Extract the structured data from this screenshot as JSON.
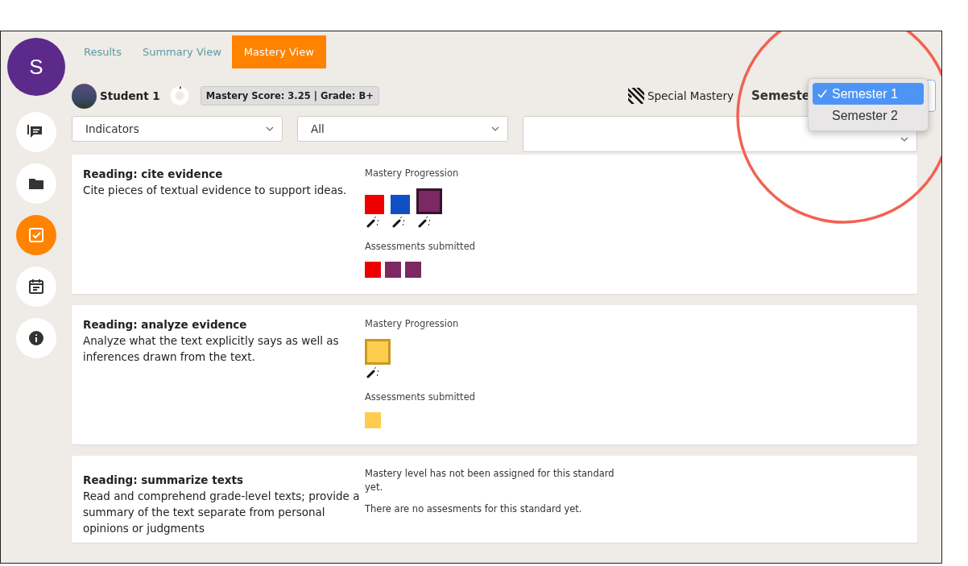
{
  "user": {
    "initial": "S"
  },
  "sidebar": {
    "items": [
      {
        "kind": "chat",
        "selected": false
      },
      {
        "kind": "folder",
        "selected": false
      },
      {
        "kind": "check",
        "selected": true
      },
      {
        "kind": "calendar",
        "selected": false
      },
      {
        "kind": "info",
        "selected": false
      }
    ]
  },
  "tabs": [
    {
      "label": "Results",
      "selected": false
    },
    {
      "label": "Summary View",
      "selected": false
    },
    {
      "label": "Mastery View",
      "selected": true
    }
  ],
  "student": {
    "name": "Student 1",
    "score_badge": "Mastery Score: 3.25 | Grade: B+",
    "legend": "Special Mastery",
    "semester_label": "Semeste"
  },
  "filters": [
    {
      "kind": "narrow",
      "value": "Indicators"
    },
    {
      "kind": "narrow",
      "value": "All"
    },
    {
      "kind": "wide"
    }
  ],
  "semester_menu": [
    {
      "label": "Semester 1",
      "selected": true
    },
    {
      "label": "Semester 2",
      "selected": false
    }
  ],
  "standards": [
    {
      "title": "Reading: cite evidence",
      "description": "Cite pieces of textual evidence to support ideas.",
      "progression_label": "Mastery Progression",
      "progression": [
        {
          "color": "#ee0000",
          "current": false
        },
        {
          "color": "#1150c4",
          "current": false
        },
        {
          "color": "#7b2863",
          "current": true
        }
      ],
      "assessments_label": "Assessments submitted",
      "assessments": [
        {
          "color": "#ee0000"
        },
        {
          "color": "#7b2863"
        },
        {
          "color": "#7b2863"
        }
      ]
    },
    {
      "title": "Reading: analyze evidence",
      "description": "Analyze what the text explicitly says as well as inferences drawn from the text.",
      "progression_label": "Mastery Progression",
      "progression": [
        {
          "color": "#ffcd4d",
          "current": true
        }
      ],
      "assessments_label": "Assessments submitted",
      "assessments": [
        {
          "color": "#ffcd4d"
        }
      ]
    },
    {
      "title": "Reading: summarize texts",
      "description": "Read and comprehend grade-level texts; provide a summary of the text separate from personal opinions or judgments",
      "messages": [
        "Mastery level has not been assigned for this standard yet.",
        "There are no assesments for this standard yet."
      ]
    }
  ]
}
